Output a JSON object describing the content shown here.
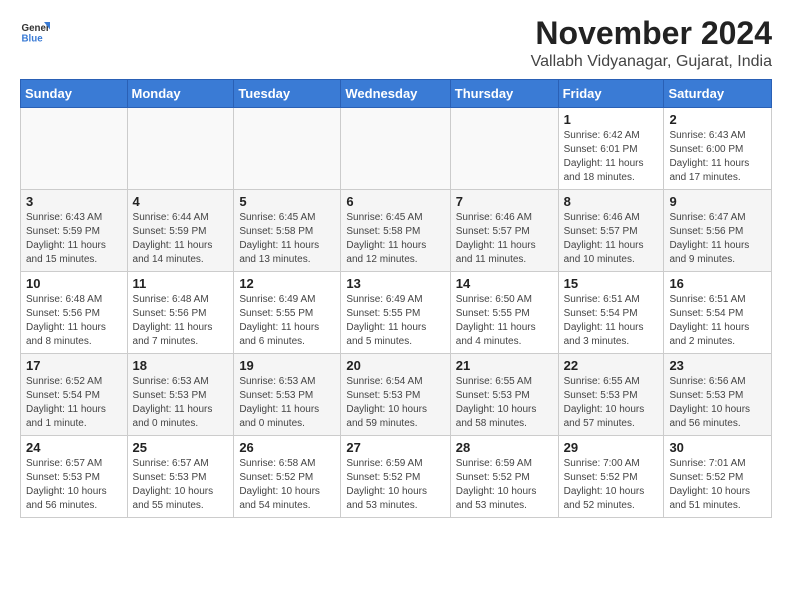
{
  "header": {
    "logo_general": "General",
    "logo_blue": "Blue",
    "month_title": "November 2024",
    "subtitle": "Vallabh Vidyanagar, Gujarat, India"
  },
  "calendar": {
    "days_of_week": [
      "Sunday",
      "Monday",
      "Tuesday",
      "Wednesday",
      "Thursday",
      "Friday",
      "Saturday"
    ],
    "weeks": [
      [
        {
          "day": "",
          "info": ""
        },
        {
          "day": "",
          "info": ""
        },
        {
          "day": "",
          "info": ""
        },
        {
          "day": "",
          "info": ""
        },
        {
          "day": "",
          "info": ""
        },
        {
          "day": "1",
          "info": "Sunrise: 6:42 AM\nSunset: 6:01 PM\nDaylight: 11 hours and 18 minutes."
        },
        {
          "day": "2",
          "info": "Sunrise: 6:43 AM\nSunset: 6:00 PM\nDaylight: 11 hours and 17 minutes."
        }
      ],
      [
        {
          "day": "3",
          "info": "Sunrise: 6:43 AM\nSunset: 5:59 PM\nDaylight: 11 hours and 15 minutes."
        },
        {
          "day": "4",
          "info": "Sunrise: 6:44 AM\nSunset: 5:59 PM\nDaylight: 11 hours and 14 minutes."
        },
        {
          "day": "5",
          "info": "Sunrise: 6:45 AM\nSunset: 5:58 PM\nDaylight: 11 hours and 13 minutes."
        },
        {
          "day": "6",
          "info": "Sunrise: 6:45 AM\nSunset: 5:58 PM\nDaylight: 11 hours and 12 minutes."
        },
        {
          "day": "7",
          "info": "Sunrise: 6:46 AM\nSunset: 5:57 PM\nDaylight: 11 hours and 11 minutes."
        },
        {
          "day": "8",
          "info": "Sunrise: 6:46 AM\nSunset: 5:57 PM\nDaylight: 11 hours and 10 minutes."
        },
        {
          "day": "9",
          "info": "Sunrise: 6:47 AM\nSunset: 5:56 PM\nDaylight: 11 hours and 9 minutes."
        }
      ],
      [
        {
          "day": "10",
          "info": "Sunrise: 6:48 AM\nSunset: 5:56 PM\nDaylight: 11 hours and 8 minutes."
        },
        {
          "day": "11",
          "info": "Sunrise: 6:48 AM\nSunset: 5:56 PM\nDaylight: 11 hours and 7 minutes."
        },
        {
          "day": "12",
          "info": "Sunrise: 6:49 AM\nSunset: 5:55 PM\nDaylight: 11 hours and 6 minutes."
        },
        {
          "day": "13",
          "info": "Sunrise: 6:49 AM\nSunset: 5:55 PM\nDaylight: 11 hours and 5 minutes."
        },
        {
          "day": "14",
          "info": "Sunrise: 6:50 AM\nSunset: 5:55 PM\nDaylight: 11 hours and 4 minutes."
        },
        {
          "day": "15",
          "info": "Sunrise: 6:51 AM\nSunset: 5:54 PM\nDaylight: 11 hours and 3 minutes."
        },
        {
          "day": "16",
          "info": "Sunrise: 6:51 AM\nSunset: 5:54 PM\nDaylight: 11 hours and 2 minutes."
        }
      ],
      [
        {
          "day": "17",
          "info": "Sunrise: 6:52 AM\nSunset: 5:54 PM\nDaylight: 11 hours and 1 minute."
        },
        {
          "day": "18",
          "info": "Sunrise: 6:53 AM\nSunset: 5:53 PM\nDaylight: 11 hours and 0 minutes."
        },
        {
          "day": "19",
          "info": "Sunrise: 6:53 AM\nSunset: 5:53 PM\nDaylight: 11 hours and 0 minutes."
        },
        {
          "day": "20",
          "info": "Sunrise: 6:54 AM\nSunset: 5:53 PM\nDaylight: 10 hours and 59 minutes."
        },
        {
          "day": "21",
          "info": "Sunrise: 6:55 AM\nSunset: 5:53 PM\nDaylight: 10 hours and 58 minutes."
        },
        {
          "day": "22",
          "info": "Sunrise: 6:55 AM\nSunset: 5:53 PM\nDaylight: 10 hours and 57 minutes."
        },
        {
          "day": "23",
          "info": "Sunrise: 6:56 AM\nSunset: 5:53 PM\nDaylight: 10 hours and 56 minutes."
        }
      ],
      [
        {
          "day": "24",
          "info": "Sunrise: 6:57 AM\nSunset: 5:53 PM\nDaylight: 10 hours and 56 minutes."
        },
        {
          "day": "25",
          "info": "Sunrise: 6:57 AM\nSunset: 5:53 PM\nDaylight: 10 hours and 55 minutes."
        },
        {
          "day": "26",
          "info": "Sunrise: 6:58 AM\nSunset: 5:52 PM\nDaylight: 10 hours and 54 minutes."
        },
        {
          "day": "27",
          "info": "Sunrise: 6:59 AM\nSunset: 5:52 PM\nDaylight: 10 hours and 53 minutes."
        },
        {
          "day": "28",
          "info": "Sunrise: 6:59 AM\nSunset: 5:52 PM\nDaylight: 10 hours and 53 minutes."
        },
        {
          "day": "29",
          "info": "Sunrise: 7:00 AM\nSunset: 5:52 PM\nDaylight: 10 hours and 52 minutes."
        },
        {
          "day": "30",
          "info": "Sunrise: 7:01 AM\nSunset: 5:52 PM\nDaylight: 10 hours and 51 minutes."
        }
      ]
    ]
  }
}
